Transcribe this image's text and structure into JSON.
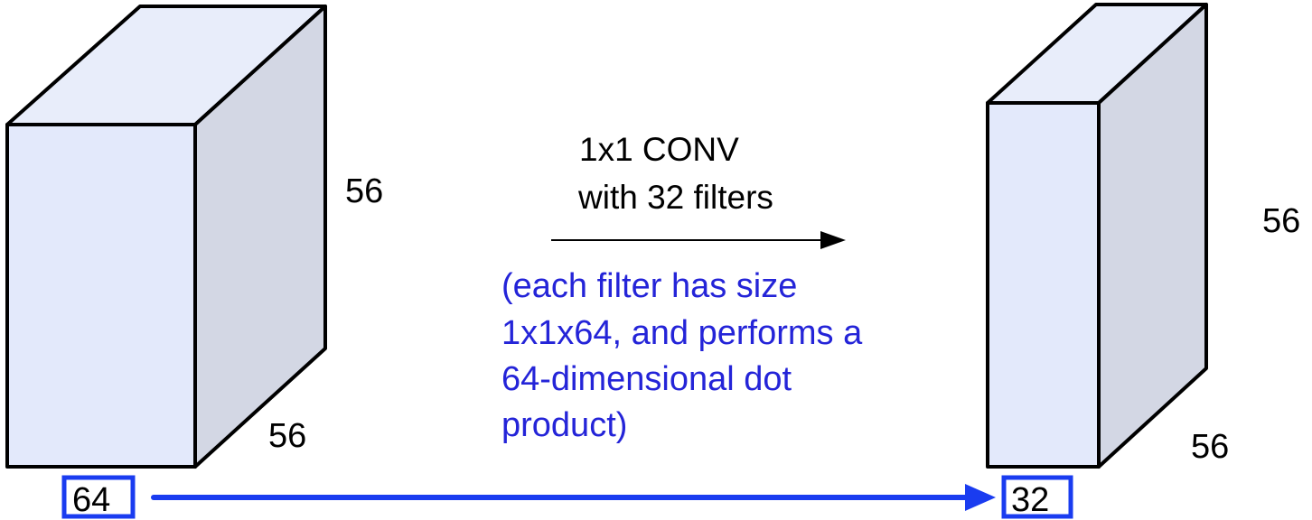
{
  "input_volume": {
    "height": "56",
    "width": "56",
    "depth": "64"
  },
  "operation": {
    "line1": "1x1 CONV",
    "line2": "with 32 filters"
  },
  "note": {
    "lines": [
      "(each filter has size",
      "1x1x64, and performs a",
      "64-dimensional dot",
      "product)"
    ]
  },
  "output_volume": {
    "height": "56",
    "width": "56",
    "depth": "32"
  },
  "colors": {
    "front_face": "#e3e9fb",
    "top_face": "#e8edfa",
    "side_face": "#d3d7e4",
    "annotation": "#2424d8",
    "highlight": "#1a3cf0"
  }
}
